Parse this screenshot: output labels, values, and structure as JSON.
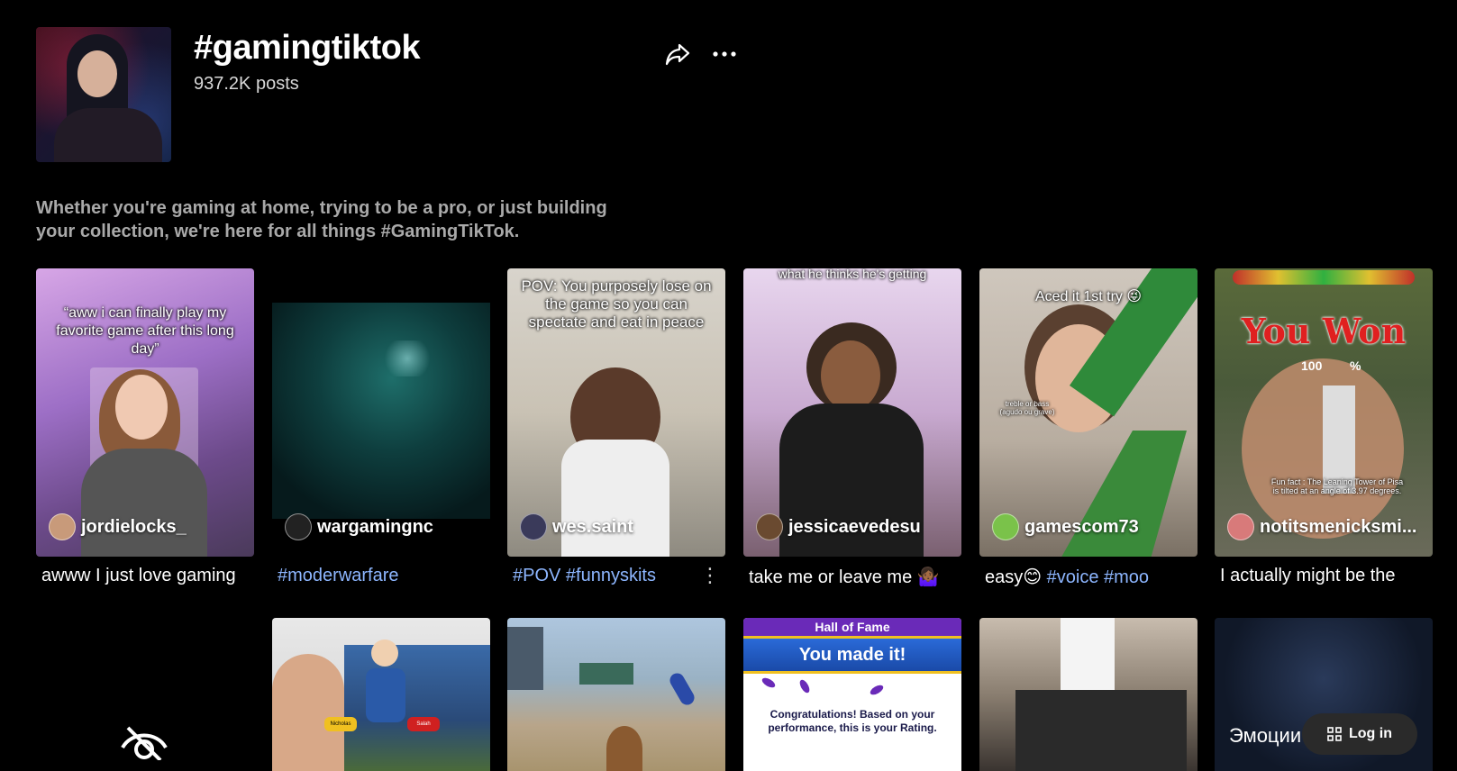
{
  "header": {
    "title": "#gamingtiktok",
    "post_count": "937.2K posts",
    "description": "Whether you're gaming at home, trying to be a pro, or just building your collection, we're here for all things #GamingTikTok."
  },
  "videos_row1": [
    {
      "creator": "jordielocks_",
      "caption_plain": "awww I just love gaming",
      "caption_tags": "",
      "overlay": "“aww i can finally play my favorite game after this long day”"
    },
    {
      "creator": "wargamingnc",
      "caption_plain": "",
      "caption_tags": "#moderwarfare",
      "overlay": ""
    },
    {
      "creator": "wes.saint",
      "caption_plain": "",
      "caption_tags": "#POV #funnyskits",
      "overlay": "POV: You purposely lose on the game so you can spectate and eat in peace"
    },
    {
      "creator": "jessicaevedesu",
      "caption_plain": "take me or leave me 🤷🏾‍♀️",
      "caption_tags": "",
      "overlay": "what he thinks he's getting"
    },
    {
      "creator": "gamescom73",
      "caption_plain": "easy😊 ",
      "caption_tags": "#voice #moo",
      "overlay": "Aced it 1st try 😜"
    },
    {
      "creator": "notitsmenicksmi...",
      "caption_plain": "I actually might be the",
      "caption_tags": "",
      "overlay": "You Won"
    }
  ],
  "overlays_extra": {
    "you_won_percent": "100",
    "percent_sign": "%",
    "fun_fact": "Fun fact : The Leaning Tower of Pisa is tilted at an angle of 3.97 degrees.",
    "treble": "treble or bass (agudo ou grave)"
  },
  "row2": {
    "hall_banner": "Hall of Fame",
    "you_made_it": "You made it!",
    "congrats": "Congratulations! Based on your performance, this is your Rating.",
    "russian": "Эмоции",
    "name1": "Nicholas",
    "name2": "Salah"
  },
  "login": {
    "label": "Log in"
  },
  "colors": {
    "hashtag": "#8db6ff",
    "background": "#000000"
  }
}
